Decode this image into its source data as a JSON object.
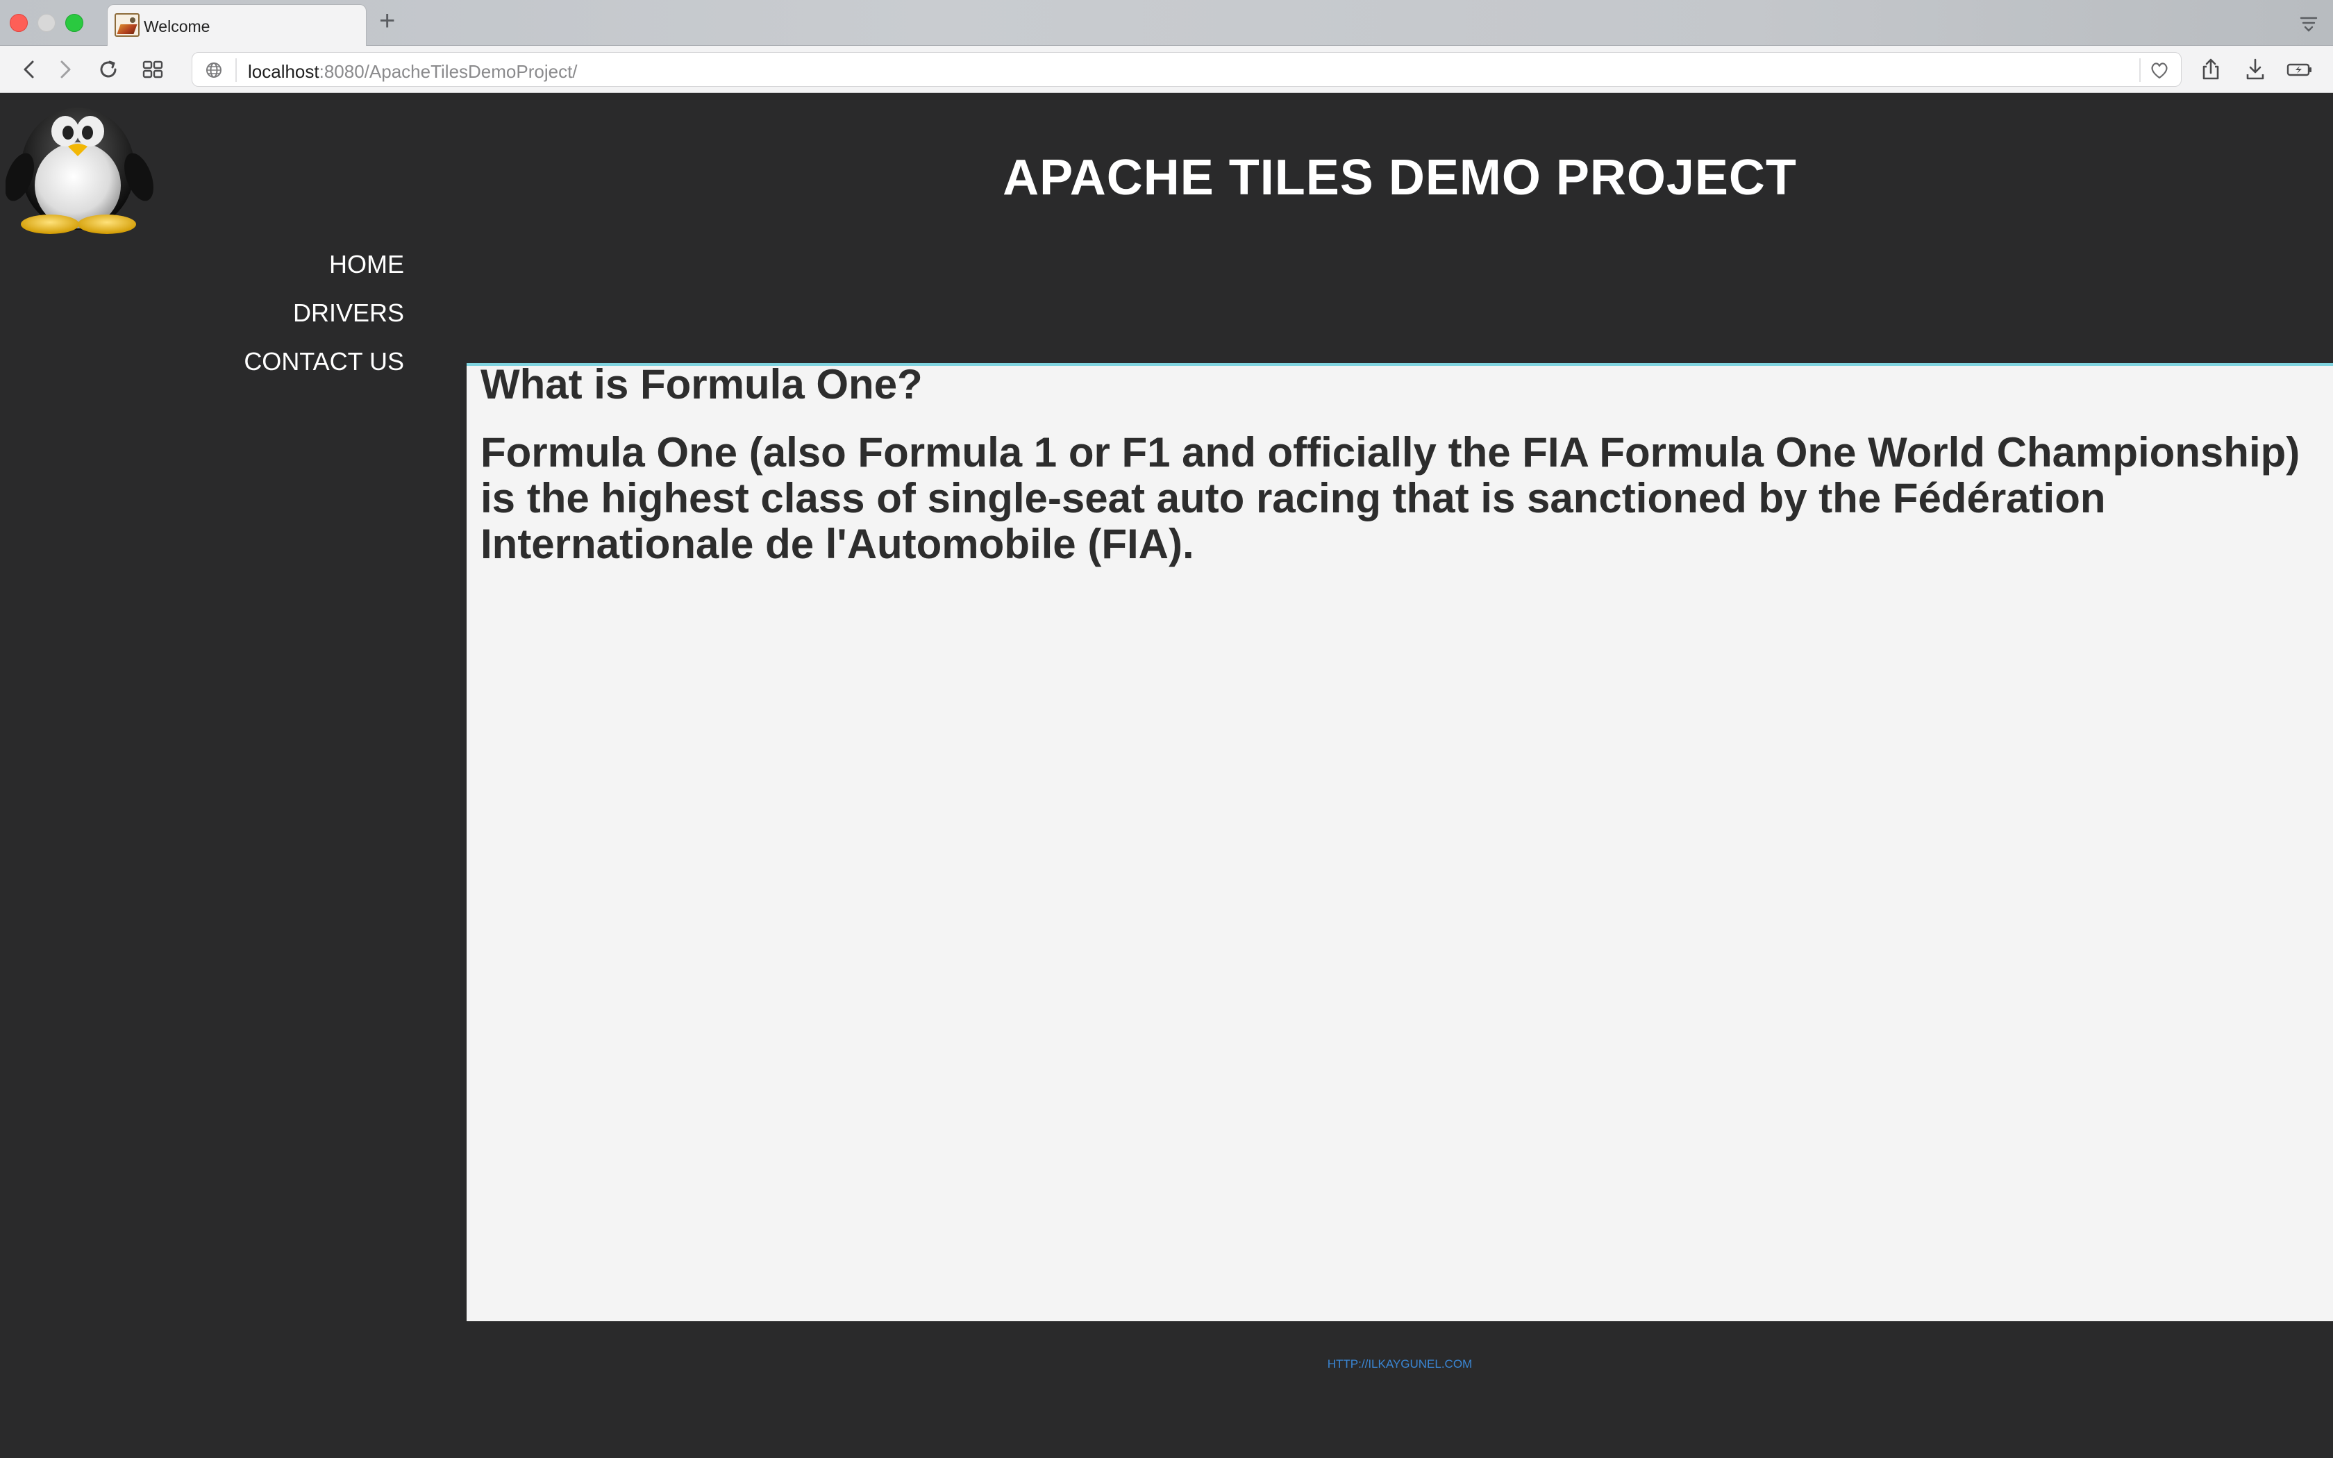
{
  "browser": {
    "tab_title": "Welcome",
    "new_tab_symbol": "+",
    "url_host": "localhost",
    "url_rest": ":8080/ApacheTilesDemoProject/",
    "icons": {
      "back": "chevron-left-icon",
      "forward": "chevron-right-icon",
      "reload": "reload-icon",
      "tabs_overview": "grid-icon",
      "site": "globe-icon",
      "bookmark": "heart-icon",
      "share": "share-icon",
      "download": "download-icon",
      "battery": "battery-icon",
      "tab_menu": "tab-list-icon"
    }
  },
  "sidebar": {
    "nav": [
      {
        "label": "HOME"
      },
      {
        "label": "DRIVERS"
      },
      {
        "label": "CONTACT US"
      }
    ]
  },
  "header": {
    "title": "APACHE TILES DEMO PROJECT"
  },
  "main": {
    "heading": "What is Formula One?",
    "body": "Formula One (also Formula 1 or F1 and officially the FIA Formula One World Championship) is the highest class of single-seat auto racing that is sanctioned by the Fédération Internationale de l'Automobile (FIA)."
  },
  "footer": {
    "link": "HTTP://ILKAYGUNEL.COM"
  },
  "colors": {
    "background": "#2a2a2b",
    "content_background": "#f4f4f4",
    "content_border": "#7fd3df",
    "footer_link": "#3a86d4",
    "heading_text": "#2d2d2d"
  }
}
